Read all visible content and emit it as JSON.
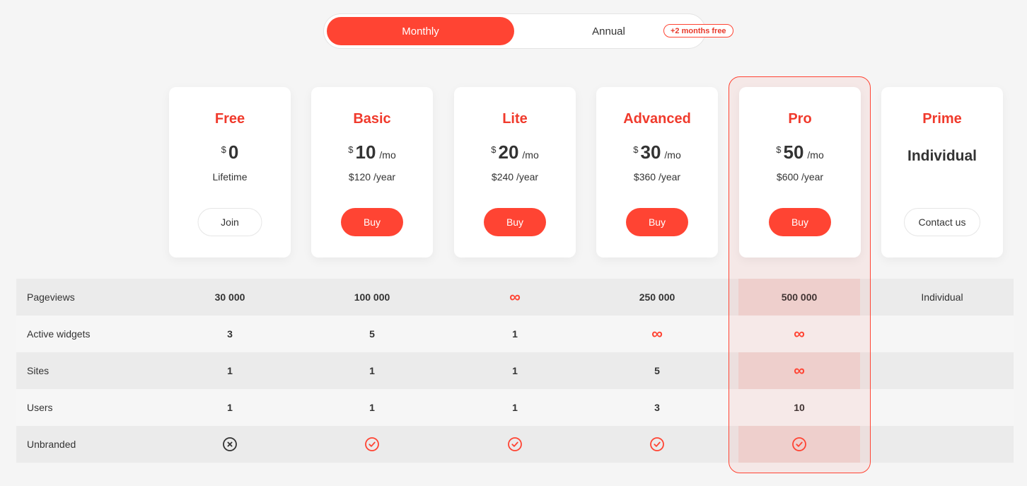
{
  "billing_toggle": {
    "options": [
      {
        "label": "Monthly",
        "selected": true
      },
      {
        "label": "Annual",
        "selected": false
      }
    ],
    "promo_badge": "+2 months free"
  },
  "accent_color": "#ff4433",
  "highlighted_plan": "Pro",
  "plans": [
    {
      "name": "Free",
      "currency": "$",
      "amount": "0",
      "period": "",
      "subtext": "Lifetime",
      "button": "Join",
      "button_style": "outline"
    },
    {
      "name": "Basic",
      "currency": "$",
      "amount": "10",
      "period": "/mo",
      "subtext": "$120 /year",
      "button": "Buy",
      "button_style": "primary"
    },
    {
      "name": "Lite",
      "currency": "$",
      "amount": "20",
      "period": "/mo",
      "subtext": "$240 /year",
      "button": "Buy",
      "button_style": "primary"
    },
    {
      "name": "Advanced",
      "currency": "$",
      "amount": "30",
      "period": "/mo",
      "subtext": "$360 /year",
      "button": "Buy",
      "button_style": "primary"
    },
    {
      "name": "Pro",
      "currency": "$",
      "amount": "50",
      "period": "/mo",
      "subtext": "$600 /year",
      "button": "Buy",
      "button_style": "primary"
    },
    {
      "name": "Prime",
      "price_text": "Individual",
      "button": "Contact us",
      "button_style": "outline"
    }
  ],
  "features": [
    {
      "label": "Pageviews",
      "values": [
        "30 000",
        "100 000",
        "infinity-icon",
        "250 000",
        "500 000",
        "Individual"
      ]
    },
    {
      "label": "Active widgets",
      "values": [
        "3",
        "5",
        "1",
        "infinity-icon",
        "infinity-icon",
        ""
      ]
    },
    {
      "label": "Sites",
      "values": [
        "1",
        "1",
        "1",
        "5",
        "infinity-icon",
        ""
      ]
    },
    {
      "label": "Users",
      "values": [
        "1",
        "1",
        "1",
        "3",
        "10",
        ""
      ]
    },
    {
      "label": "Unbranded",
      "values": [
        "cross-circle-icon",
        "check-circle-icon",
        "check-circle-icon",
        "check-circle-icon",
        "check-circle-icon",
        ""
      ]
    }
  ]
}
